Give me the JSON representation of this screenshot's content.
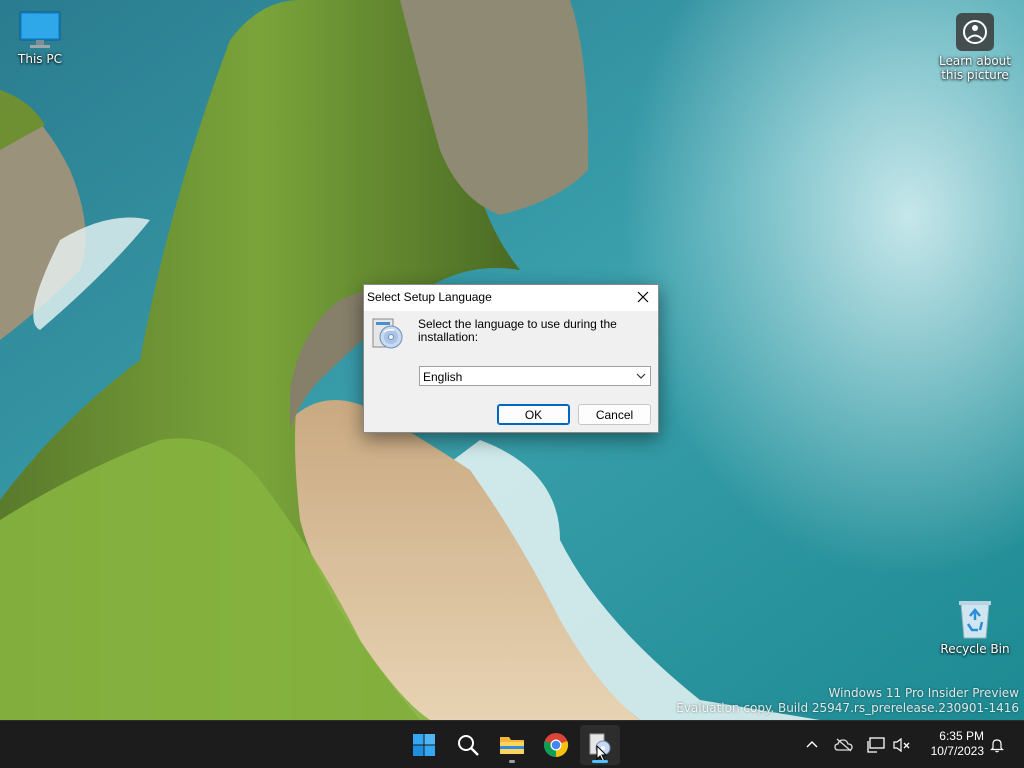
{
  "desktop": {
    "icons": [
      {
        "label": "This PC",
        "icon": "monitor-icon"
      },
      {
        "label": "Learn about this picture",
        "icon": "info-camera-icon"
      },
      {
        "label": "Recycle Bin",
        "icon": "recycle-bin-icon"
      }
    ],
    "watermark": {
      "line1": "Windows 11 Pro Insider Preview",
      "line2": "Evaluation copy. Build 25947.rs_prerelease.230901-1416"
    }
  },
  "dialog": {
    "title": "Select Setup Language",
    "prompt": "Select the language to use during the installation:",
    "language_selected": "English",
    "ok_label": "OK",
    "cancel_label": "Cancel"
  },
  "taskbar": {
    "apps": [
      "start-icon",
      "search-icon",
      "file-explorer-icon",
      "chrome-icon",
      "setup-app-icon"
    ],
    "tray": [
      "chevron-up-icon",
      "onedrive-icon",
      "network-icon",
      "volume-muted-icon"
    ],
    "time": "6:35 PM",
    "date": "10/7/2023"
  },
  "colors": {
    "accent": "#0067c0",
    "taskbar": "#1c1c1c",
    "dialog_bg": "#f0f0f0"
  }
}
